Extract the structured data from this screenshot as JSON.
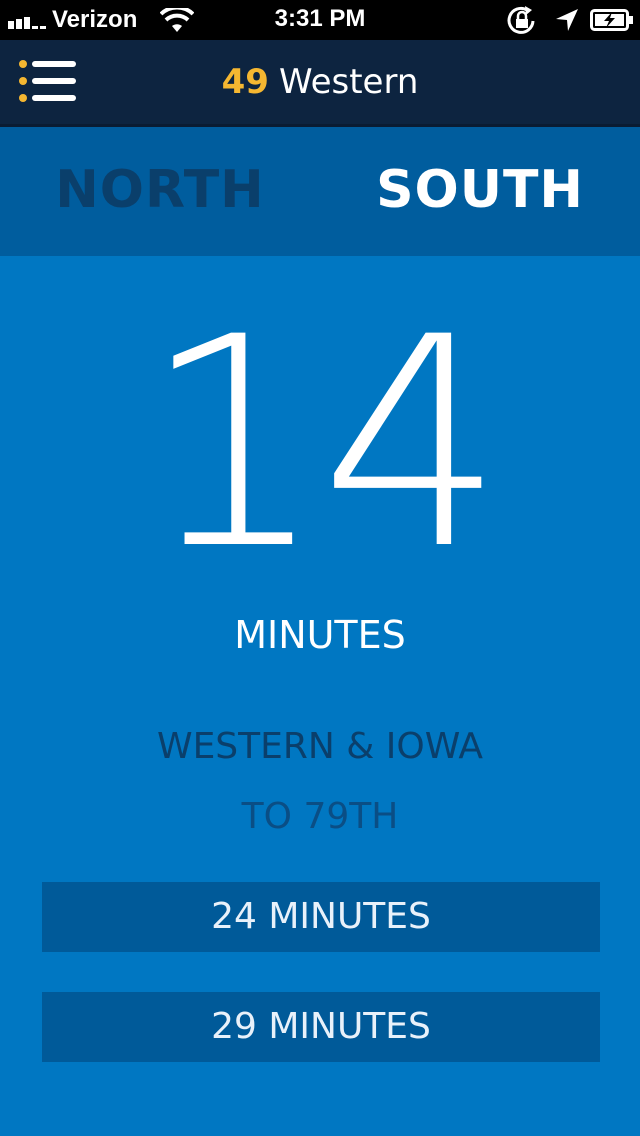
{
  "status_bar": {
    "carrier": "Verizon",
    "time": "3:31 PM",
    "icons": [
      "signal-icon",
      "wifi-icon",
      "orientation-lock-icon",
      "location-arrow-icon",
      "battery-charging-icon"
    ]
  },
  "header": {
    "route_number": "49",
    "route_name": "Western",
    "menu_icon": "menu-list-icon"
  },
  "direction_tabs": {
    "north_label": "NORTH",
    "south_label": "SOUTH",
    "selected": "SOUTH"
  },
  "arrival": {
    "next_minutes": "14",
    "minutes_label": "MINUTES",
    "stop_name": "WESTERN & IOWA",
    "destination": "TO 79TH",
    "upcoming": [
      {
        "label": "24 MINUTES"
      },
      {
        "label": "29 MINUTES"
      }
    ]
  },
  "colors": {
    "background": "#0077c2",
    "tab_bar": "#005d9e",
    "nav_bar": "#0d2440",
    "accent": "#f5b731",
    "inactive_text": "#0a3f6b",
    "row_background": "#005a99"
  }
}
